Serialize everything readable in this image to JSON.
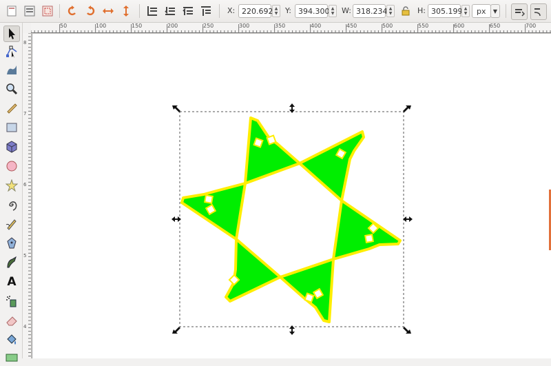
{
  "toolbar": {
    "x_label": "X:",
    "x_value": "220.692",
    "y_label": "Y:",
    "y_value": "394.300",
    "w_label": "W:",
    "w_value": "318.234",
    "h_label": "H:",
    "h_value": "305.199",
    "unit": "px",
    "icons": [
      "select-all-icon",
      "select-all-layers-icon",
      "deselect-icon",
      "rotate-ccw-icon",
      "rotate-cw-icon",
      "flip-horizontal-icon",
      "flip-vertical-icon",
      "lower-to-bottom-icon",
      "lower-icon",
      "raise-icon",
      "raise-to-top-icon",
      "lock-ratio-icon",
      "transform-scale-stroke-icon",
      "transform-rounded-corners-icon"
    ]
  },
  "ruler": {
    "h_labels": [
      "50",
      "100",
      "150",
      "200",
      "250",
      "300",
      "350",
      "400",
      "450",
      "500",
      "550",
      "600",
      "650",
      "700"
    ],
    "v_labels": [
      "8",
      "7",
      "6",
      "5",
      "4"
    ]
  },
  "toolbox": {
    "tools": [
      "selector-tool-icon",
      "node-tool-icon",
      "tweak-tool-icon",
      "zoom-tool-icon",
      "measure-tool-icon",
      "rectangle-tool-icon",
      "3d-box-tool-icon",
      "ellipse-tool-icon",
      "star-tool-icon",
      "spiral-tool-icon",
      "pencil-tool-icon",
      "pen-tool-icon",
      "calligraphy-tool-icon",
      "text-tool-icon",
      "spray-tool-icon",
      "eraser-tool-icon",
      "paint-bucket-tool-icon",
      "gradient-tool-icon"
    ],
    "text_tool_glyph": "A"
  },
  "colors": {
    "star_fill": "#00ee00",
    "star_stroke": "#ffee00",
    "accent": "#e2703a"
  }
}
